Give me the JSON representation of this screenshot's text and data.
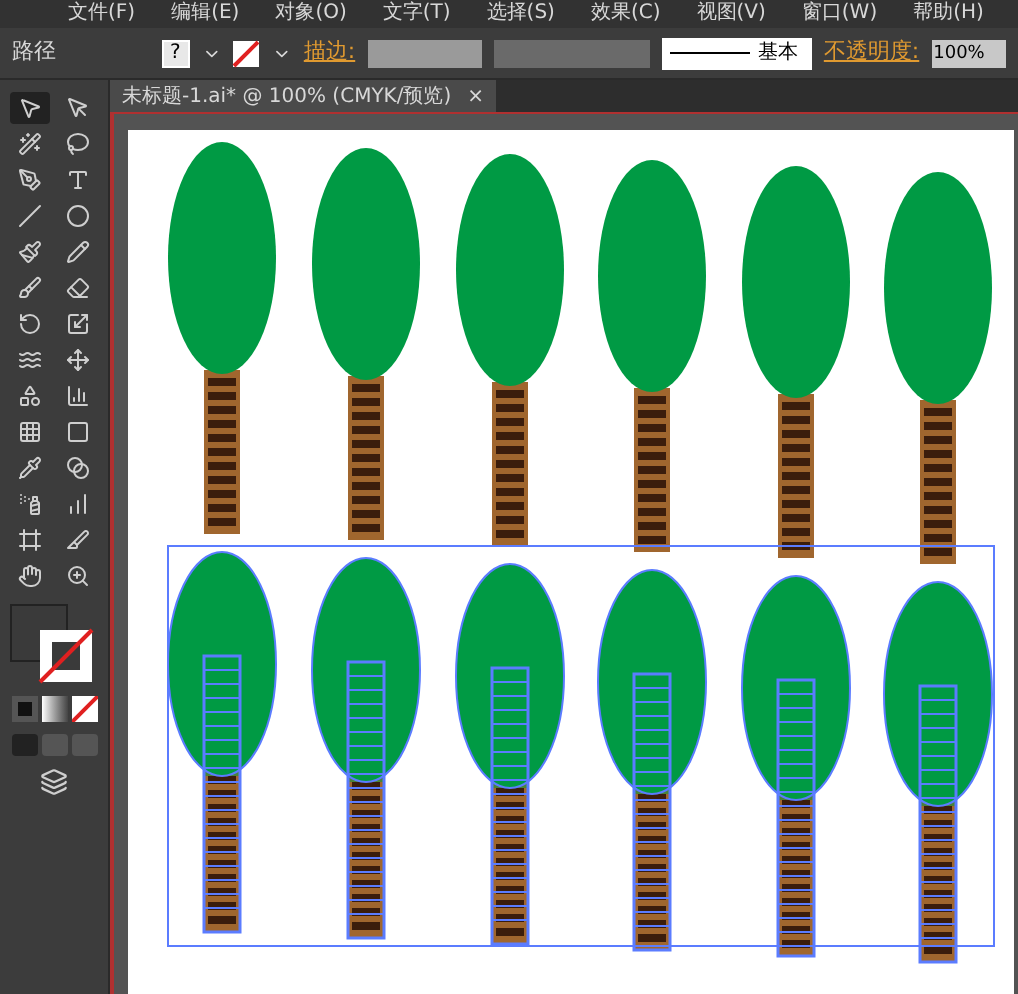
{
  "menu": [
    "文件(F)",
    "编辑(E)",
    "对象(O)",
    "文字(T)",
    "选择(S)",
    "效果(C)",
    "视图(V)",
    "窗口(W)",
    "帮助(H)"
  ],
  "control_bar": {
    "object_type": "路径",
    "fill_glyph": "?",
    "stroke_label": "描边:",
    "stroke_style": "基本",
    "opacity_label": "不透明度:",
    "opacity_value": "100%"
  },
  "document_tab": {
    "title": "未标题-1.ai* @ 100% (CMYK/预览)",
    "close": "×",
    "selected": true
  },
  "tools": [
    {
      "selected": true
    },
    {
      "selected": false
    },
    {
      "selected": false
    },
    {
      "selected": false
    },
    {
      "selected": false
    },
    {
      "selected": false
    },
    {
      "selected": false
    },
    {
      "selected": false
    },
    {
      "selected": false
    },
    {
      "selected": false
    },
    {
      "selected": false
    },
    {
      "selected": false
    },
    {
      "selected": false
    },
    {
      "selected": false
    },
    {
      "selected": false
    },
    {
      "selected": false
    },
    {
      "selected": false
    },
    {
      "selected": false
    },
    {
      "selected": false
    },
    {
      "selected": false
    },
    {
      "selected": false
    },
    {
      "selected": false
    },
    {
      "selected": false
    },
    {
      "selected": false
    },
    {
      "selected": false
    },
    {
      "selected": false
    },
    {
      "selected": false
    },
    {
      "selected": false
    }
  ],
  "trees": [
    {
      "selected": false
    },
    {
      "selected": false
    },
    {
      "selected": false
    },
    {
      "selected": false
    },
    {
      "selected": false
    },
    {
      "selected": false
    },
    {
      "selected": true
    },
    {
      "selected": true
    },
    {
      "selected": true
    },
    {
      "selected": true
    },
    {
      "selected": true
    },
    {
      "selected": true
    }
  ]
}
